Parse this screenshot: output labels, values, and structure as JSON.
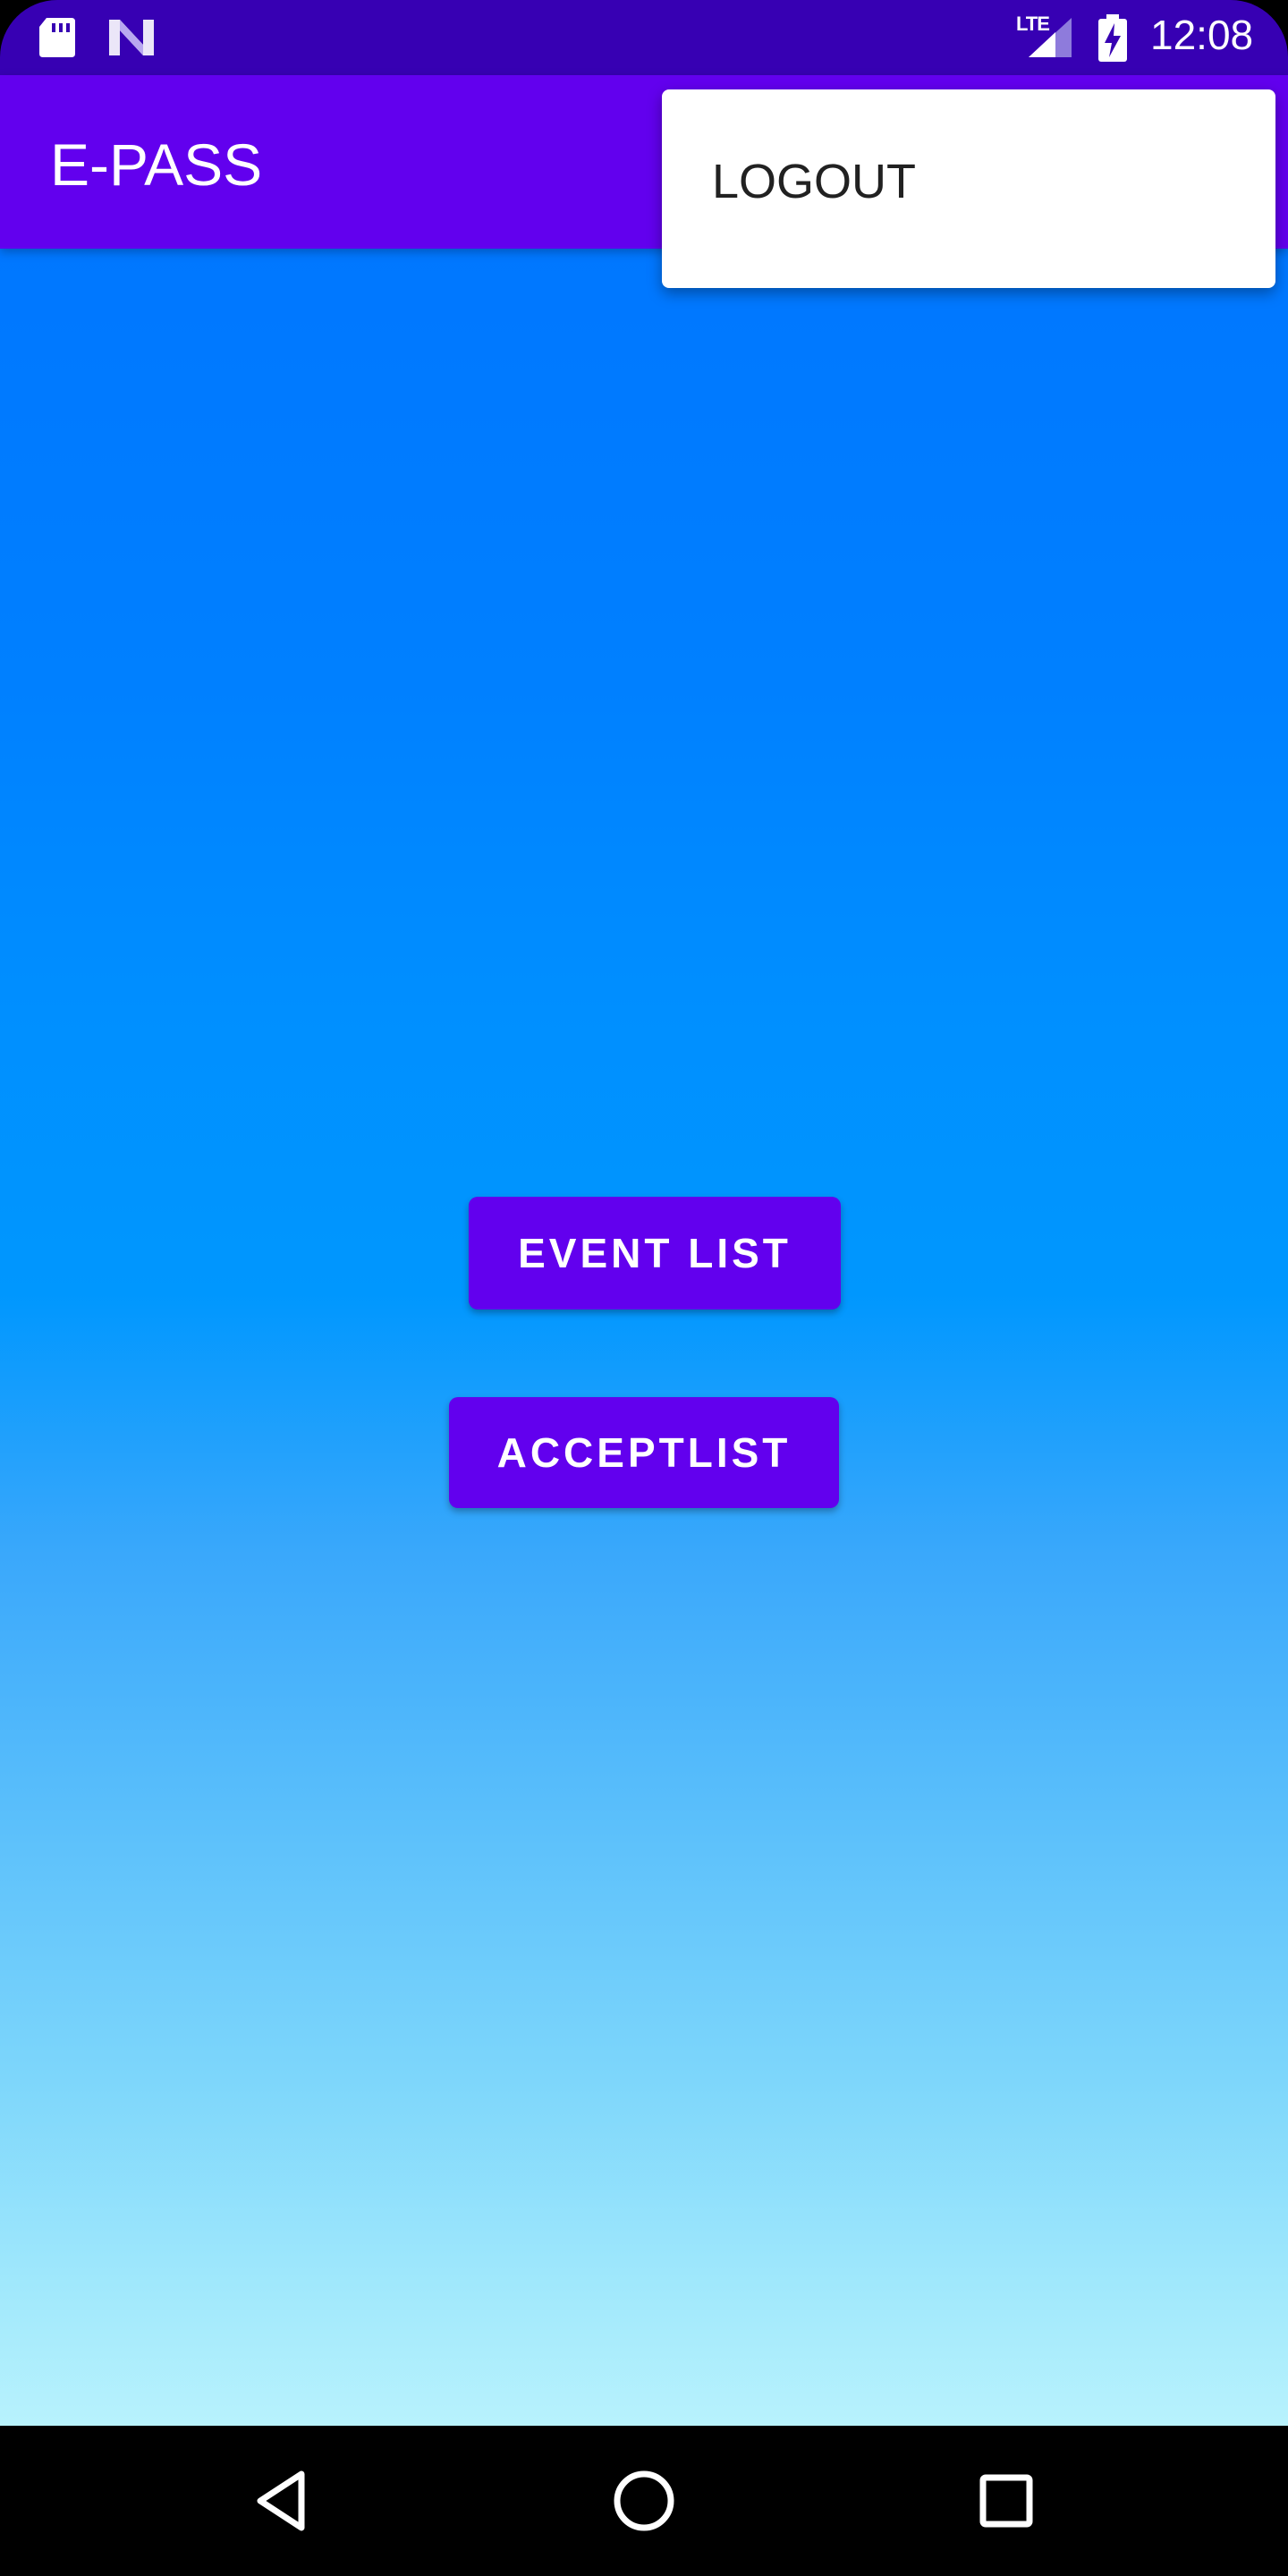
{
  "status_bar": {
    "network_type": "LTE",
    "time": "12:08",
    "icons": [
      "sd-card-icon",
      "n-notification-icon",
      "signal-icon",
      "battery-charging-icon"
    ]
  },
  "app_bar": {
    "title": "E-PASS"
  },
  "popup_menu": {
    "items": [
      {
        "label": "LOGOUT"
      }
    ]
  },
  "main": {
    "buttons": [
      {
        "label": "EVENT LIST"
      },
      {
        "label": "ACCEPTLIST"
      }
    ]
  },
  "nav_bar": {
    "icons": [
      "back-icon",
      "home-icon",
      "recents-icon"
    ]
  },
  "colors": {
    "status_bar": "#3700B3",
    "primary": "#6200EE",
    "gradient_top": "#0077FF",
    "gradient_bottom": "#B8F2FD",
    "menu_background": "#FFFFFF",
    "menu_text": "#212121"
  }
}
